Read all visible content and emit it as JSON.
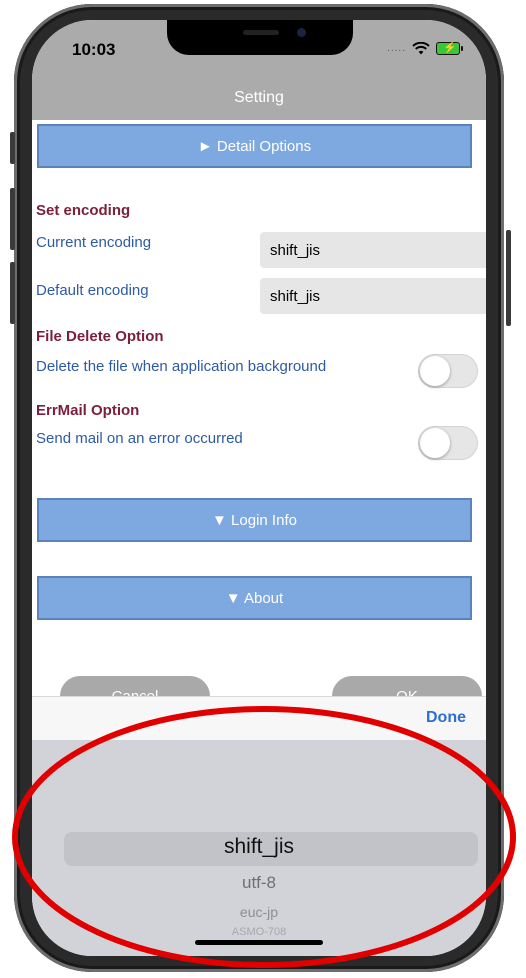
{
  "status": {
    "time": "10:03",
    "signal": "....."
  },
  "nav": {
    "title": "Setting"
  },
  "sections": {
    "detail_label": "► Detail Options",
    "login_label": "▼ Login Info",
    "about_label": "▼ About"
  },
  "encoding": {
    "heading": "Set encoding",
    "current_label": "Current encoding",
    "current_value": "shift_jis",
    "default_label": "Default encoding",
    "default_value": "shift_jis"
  },
  "file_delete": {
    "heading": "File Delete Option",
    "label": "Delete the file when application background",
    "enabled": false
  },
  "err_mail": {
    "heading": "ErrMail Option",
    "label": "Send mail on an error occurred",
    "enabled": false
  },
  "actions": {
    "cancel_label": "Cancel",
    "ok_label": "OK"
  },
  "picker": {
    "done_label": "Done",
    "selected": "shift_jis",
    "options": [
      "shift_jis",
      "utf-8",
      "euc-jp",
      "ASMO-708"
    ]
  },
  "colors": {
    "section_button": "#7ea9e0",
    "heading": "#7b1f3a",
    "label": "#2d5aa5",
    "annotation": "#e00000"
  }
}
